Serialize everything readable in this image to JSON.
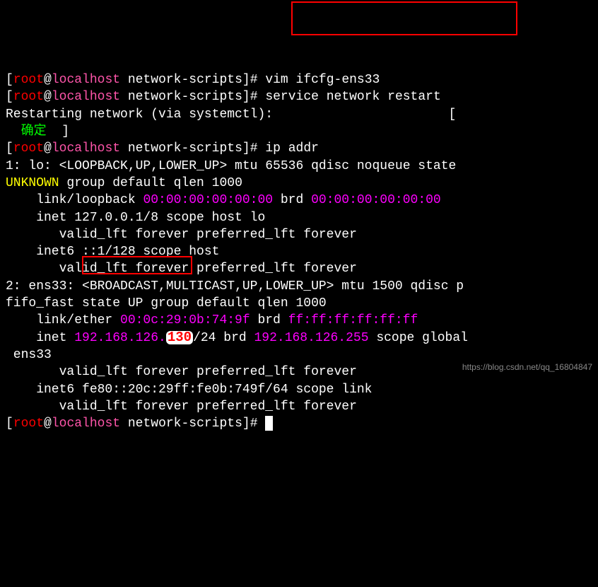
{
  "prompt": {
    "user": "root",
    "at": "@",
    "host": "localhost",
    "path": " network-scripts",
    "marker": "]#"
  },
  "cmds": {
    "vim": "vim ifcfg-ens33",
    "restart": "service network restart",
    "ipaddr": "ip addr"
  },
  "restart_line": "Restarting network (via systemctl):                       [",
  "ok": "  确定",
  "ok_close": "  ]",
  "lo": {
    "l1": "1: lo: <LOOPBACK,UP,LOWER_UP> mtu 65536 qdisc noqueue state ",
    "unknown": "UNKNOWN",
    "l1b": " group default qlen 1000",
    "link": "    link/loopback ",
    "mac": "00:00:00:00:00:00",
    "brd": " brd ",
    "mac2": "00:00:00:00:00:00",
    "inet": "    inet 127.0.0.1/8 scope host lo",
    "valid": "       valid_lft forever preferred_lft forever",
    "inet6": "    inet6 ::1/128 scope host",
    "valid2": "       valid_lft forever preferred_lft forever"
  },
  "ens": {
    "l1": "2: ens33: <BROADCAST,MULTICAST,UP,LOWER_UP> mtu 1500 qdisc p",
    "l1b": "fifo_fast state UP group default qlen 1000",
    "link": "    link/ether ",
    "mac": "00:0c:29:0b:74:9f",
    "brd": " brd ",
    "macbrd": "ff:ff:ff:ff:ff:ff",
    "inet_pre": "    inet ",
    "ip_a": "192.168.126.",
    "ip_badge": "130",
    "ip_suffix": "/24 brd ",
    "ip_brd": "192.168.126.255",
    "ip_tail": " scope global",
    "ens_tail": " ens33",
    "valid": "       valid_lft forever preferred_lft forever",
    "inet6": "    inet6 fe80::20c:29ff:fe0b:749f/64 scope link",
    "valid2": "       valid_lft forever preferred_lft forever"
  },
  "watermark": "https://blog.csdn.net/qq_16804847"
}
